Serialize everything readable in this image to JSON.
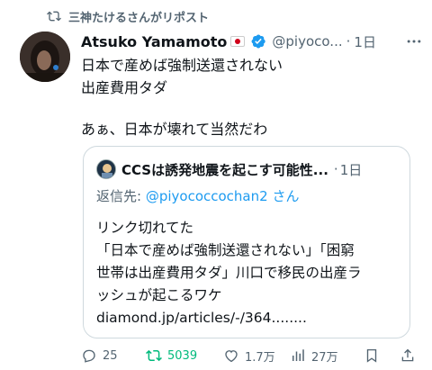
{
  "repost_banner": {
    "text": "三神たけるさんがリポスト"
  },
  "tweet": {
    "author_name": "Atsuko Yamamoto",
    "handle": "@piyoco...",
    "separator": "·",
    "time": "1日",
    "lines": [
      "日本で産めば強制送還されない",
      "出産費用タダ",
      "",
      "あぁ、日本が壊れて当然だわ"
    ]
  },
  "quote": {
    "title": "CCSは誘発地震を起こす可能性...",
    "separator": "·",
    "time": "1日",
    "reply_prefix": "返信先: ",
    "reply_mention": "@piyococcochan2",
    "reply_suffix": " さん",
    "lines": [
      "リンク切れてた",
      "「日本で産めば強制送還されない」「困窮",
      "世帯は出産費用タダ」川口で移民の出産ラ",
      "ッシュが起こるワケ",
      "diamond.jp/articles/-/364........"
    ]
  },
  "actions": {
    "replies": "25",
    "reposts": "5039",
    "likes": "1.7万",
    "views": "27万"
  },
  "colors": {
    "accent": "#1d9bf0",
    "repost_green": "#00ba7c",
    "muted": "#536471"
  }
}
